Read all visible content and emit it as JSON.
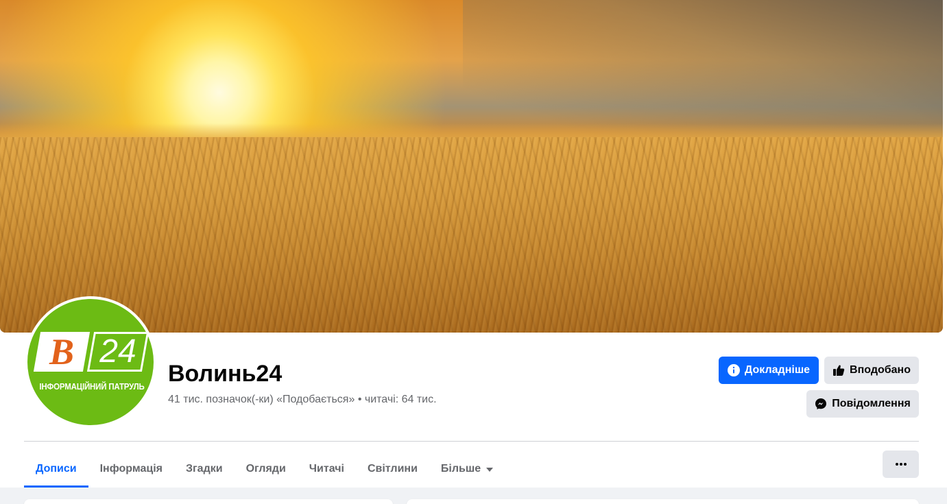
{
  "page": {
    "name": "Волинь24",
    "stats": "41 тис. позначок(-ки) «Подобається» • читачі: 64 тис."
  },
  "logo": {
    "letter": "B",
    "number": "24",
    "tagline": "ІНФОРМАЦІЙНИЙ ПАТРУЛЬ"
  },
  "actions": {
    "details_label": "Докладніше",
    "like_label": "Вподобано",
    "message_label": "Повідомлення"
  },
  "tabs": [
    {
      "label": "Дописи",
      "active": true
    },
    {
      "label": "Інформація",
      "active": false
    },
    {
      "label": "Згадки",
      "active": false
    },
    {
      "label": "Огляди",
      "active": false
    },
    {
      "label": "Читачі",
      "active": false
    },
    {
      "label": "Світлини",
      "active": false
    },
    {
      "label": "Більше",
      "active": false
    }
  ],
  "icons": {
    "details": "info-icon",
    "like": "thumbs-up-icon",
    "message": "messenger-icon",
    "more": "ellipsis-icon"
  },
  "colors": {
    "accent": "#0866ff",
    "logo_green": "#6cbb14",
    "logo_orange": "#e2621b"
  }
}
